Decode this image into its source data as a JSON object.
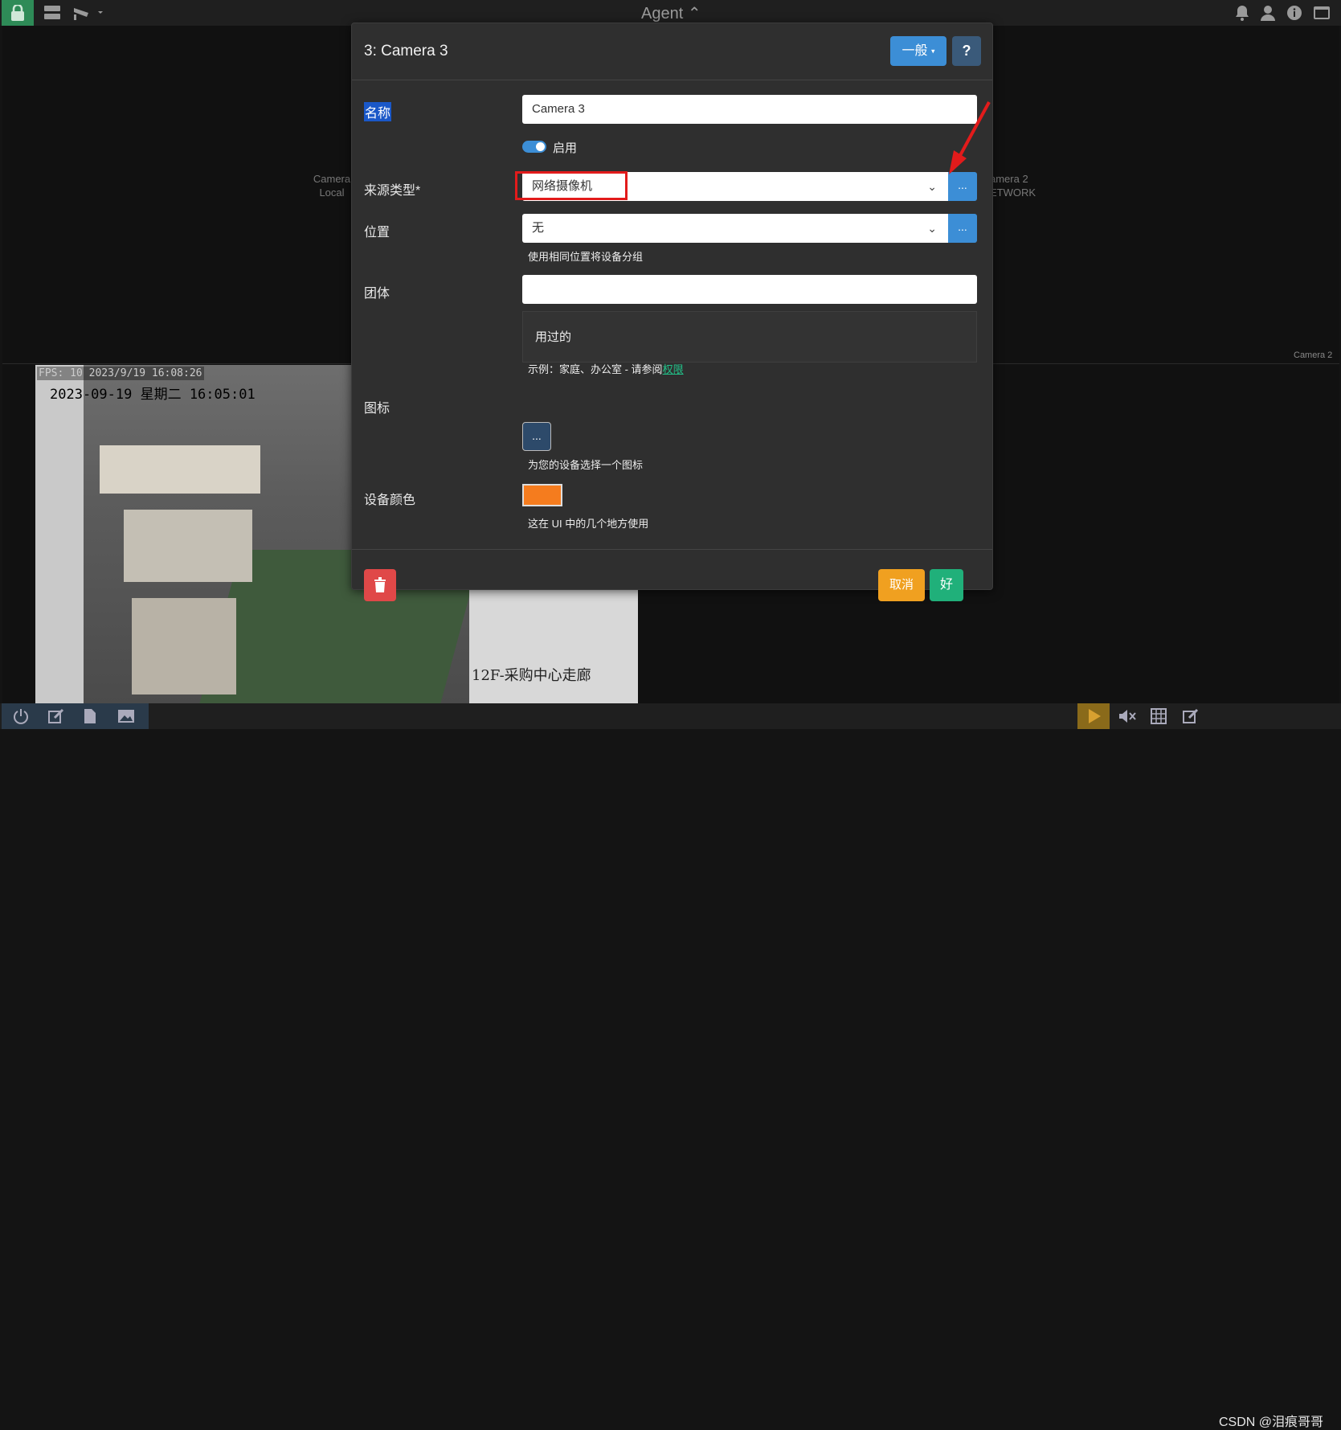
{
  "topbar": {
    "title": "Agent"
  },
  "grid": {
    "camera_left": {
      "name": "Camera",
      "type": "Local"
    },
    "camera_right": {
      "name": "amera 2",
      "type": "ETWORK"
    },
    "camera_right_tag": "Camera 2"
  },
  "feed": {
    "fps": "FPS: 10 2023/9/19 16:08:26",
    "osd_time": "2023-09-19 星期二 16:05:01",
    "osd_location": "12F-采购中心走廊"
  },
  "modal": {
    "title": "3: Camera 3",
    "general_btn": "一般",
    "help_btn": "?",
    "name_label": "名称",
    "name_value": "Camera 3",
    "enable_label": "启用",
    "source_label": "来源类型*",
    "source_value": "网络摄像机",
    "location_label": "位置",
    "location_value": "无",
    "location_help": "使用相同位置将设备分组",
    "group_label": "团体",
    "group_value": "",
    "used_label": "用过的",
    "group_help_prefix": "示例：家庭、办公室 - 请参阅",
    "group_help_link": "权限",
    "icon_label": "图标",
    "icon_btn": "...",
    "icon_help": "为您的设备选择一个图标",
    "color_label": "设备颜色",
    "device_color": "#f57c1e",
    "color_help": "这在 UI 中的几个地方使用",
    "dots": "...",
    "cancel_btn": "取消",
    "ok_btn": "好"
  },
  "watermark": "CSDN @泪痕哥哥"
}
